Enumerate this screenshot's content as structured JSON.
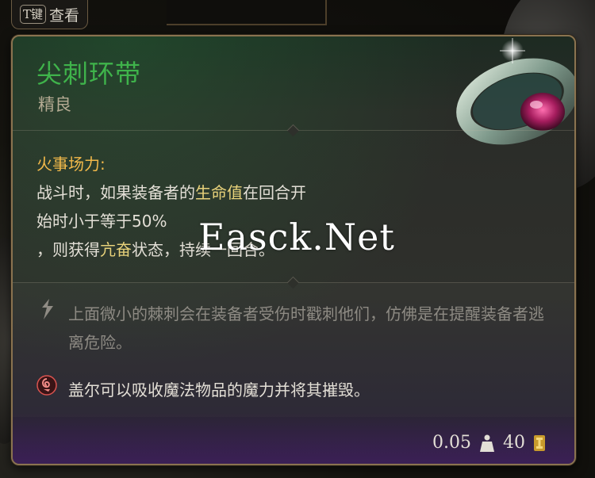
{
  "key_hint": {
    "key": "T键",
    "label": "查看"
  },
  "item": {
    "name": "尖刺环带",
    "rarity": "精良",
    "effect": {
      "title": "火事场力:",
      "line1_a": "战斗时，如果装备者的",
      "line1_hl": "生命值",
      "line1_b": "在回合开",
      "line2": "始时小于等于50%",
      "line3_a": "，则获得",
      "line3_hl": "亢奋",
      "line3_b": "状态，持续一回合。"
    },
    "flavor": "上面微小的棘刺会在装备者受伤时戳刺他们，仿佛是在提醒装备者逃离危险。",
    "note": "盖尔可以吸收魔法物品的魔力并将其摧毁。",
    "weight": "0.05",
    "value": "40"
  },
  "watermark": "Easck.Net",
  "colors": {
    "name_green": "#3fb34b",
    "effect_title": "#f2b94a",
    "highlight": "#e8d27a",
    "border_gold": "#8a7350"
  },
  "icons": {
    "item_art": "ring-icon",
    "flavor": "thorn-icon",
    "note": "gale-spiral-icon",
    "weight": "weight-icon",
    "value": "gold-coin-icon"
  }
}
